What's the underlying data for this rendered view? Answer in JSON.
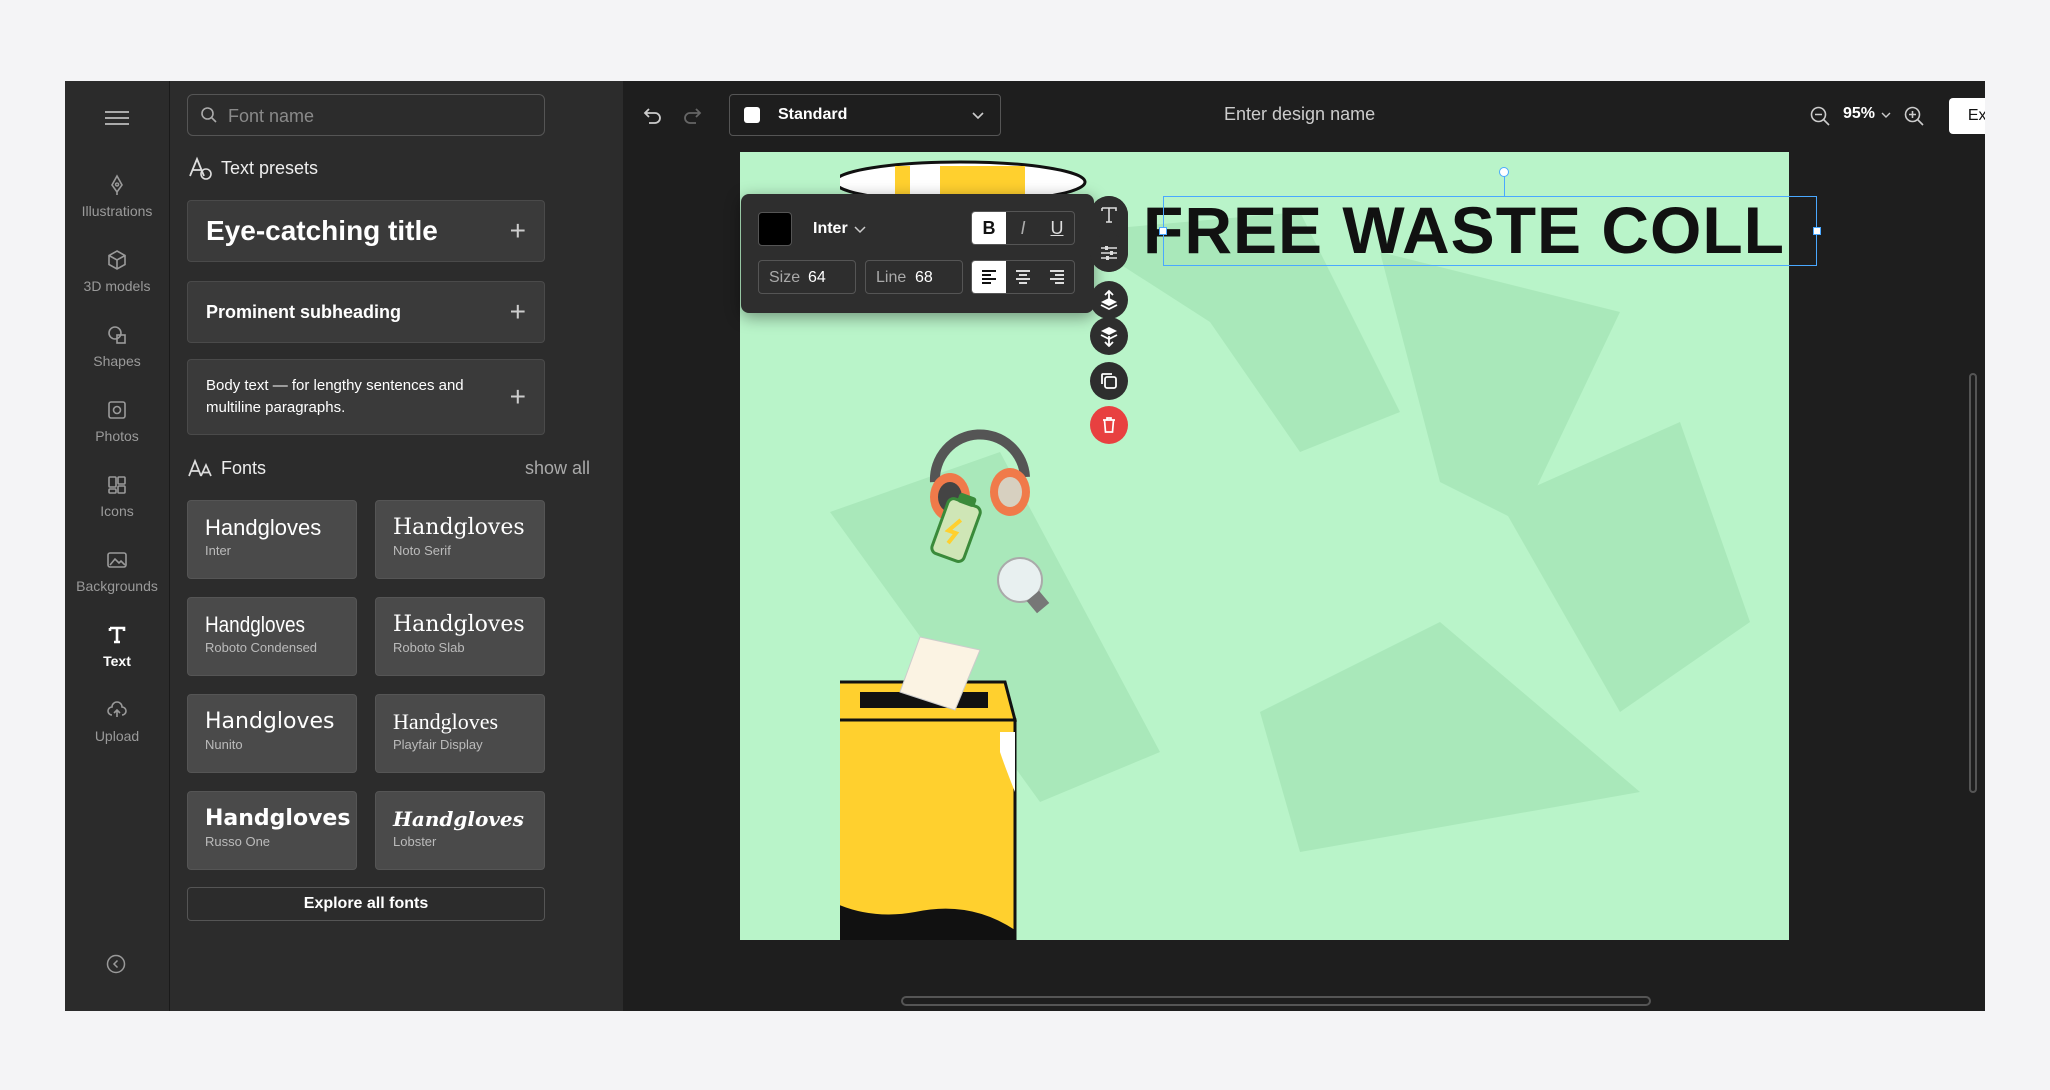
{
  "rail": {
    "items": [
      {
        "label": "Illustrations",
        "icon": "pen-nib-icon"
      },
      {
        "label": "3D models",
        "icon": "cube-icon"
      },
      {
        "label": "Shapes",
        "icon": "shapes-icon"
      },
      {
        "label": "Photos",
        "icon": "photo-icon"
      },
      {
        "label": "Icons",
        "icon": "icons-icon"
      },
      {
        "label": "Backgrounds",
        "icon": "image-icon"
      },
      {
        "label": "Text",
        "icon": "text-icon"
      },
      {
        "label": "Upload",
        "icon": "upload-cloud-icon"
      }
    ],
    "active": "Text"
  },
  "panel": {
    "search_placeholder": "Font name",
    "presets_title": "Text presets",
    "presets": [
      {
        "label": "Eye-catching title"
      },
      {
        "label": "Prominent subheading"
      },
      {
        "label": "Body text — for lengthy sentences and multiline paragraphs."
      }
    ],
    "fonts_title": "Fonts",
    "show_all": "show all",
    "fonts": [
      {
        "sample": "Handgloves",
        "name": "Inter"
      },
      {
        "sample": "Handgloves",
        "name": "Noto Serif"
      },
      {
        "sample": "Handgloves",
        "name": "Roboto Condensed"
      },
      {
        "sample": "Handgloves",
        "name": "Roboto Slab"
      },
      {
        "sample": "Handgloves",
        "name": "Nunito"
      },
      {
        "sample": "Handgloves",
        "name": "Playfair Display"
      },
      {
        "sample": "Handgloves",
        "name": "Russo One"
      },
      {
        "sample": "Handgloves",
        "name": "Lobster"
      }
    ],
    "explore": "Explore all fonts"
  },
  "topbar": {
    "format": "Standard",
    "design_name_placeholder": "Enter design name",
    "zoom": "95%",
    "export": "Export"
  },
  "canvas": {
    "headline": "FREE WASTE COLL",
    "background": "#b9f4c9"
  },
  "text_toolbar": {
    "font": "Inter",
    "size_label": "Size",
    "size": "64",
    "line_label": "Line",
    "line": "68",
    "bold": "B",
    "italic": "I",
    "underline": "U",
    "color": "#000000"
  }
}
